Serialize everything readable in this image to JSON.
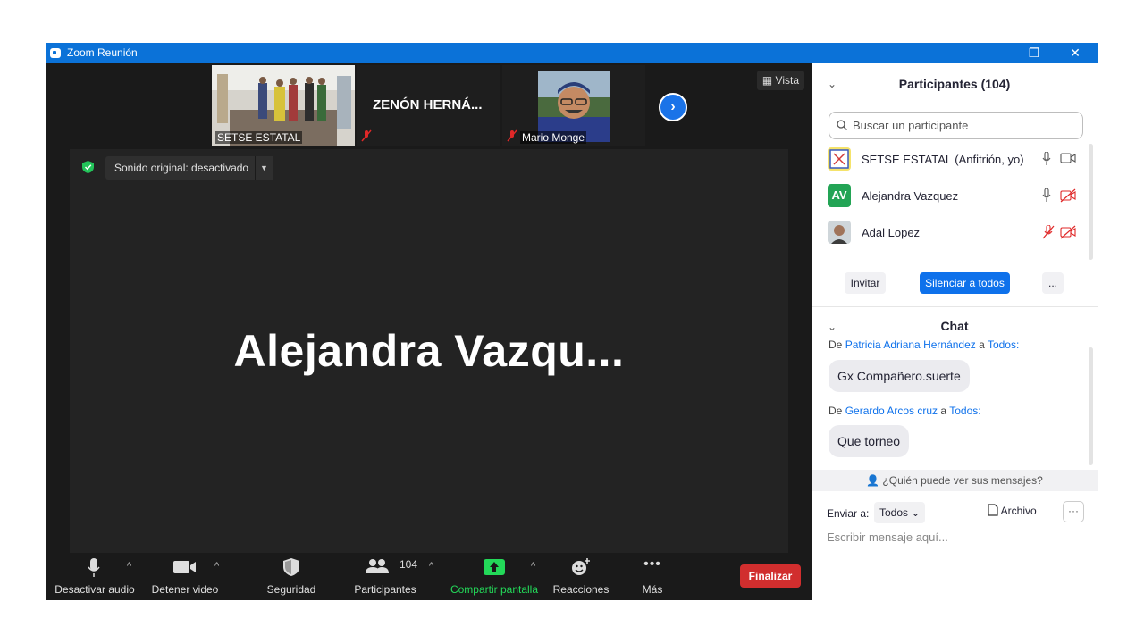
{
  "window": {
    "title": "Zoom Reunión",
    "minimize": "—",
    "restore": "❐",
    "close": "✕"
  },
  "gallery": {
    "thumbs": [
      {
        "name": "SETSE ESTATAL"
      },
      {
        "name": "ZENÓN  HERNÁ..."
      },
      {
        "name": "Mario  Monge"
      }
    ],
    "vista_label": "Vista",
    "next_arrow": "›"
  },
  "main": {
    "sound_original": "Sonido original: desactivado",
    "speaker_name": "Alejandra  Vazqu..."
  },
  "toolbar": {
    "audio": "Desactivar audio",
    "video": "Detener video",
    "security": "Seguridad",
    "participants": "Participantes",
    "participants_count": "104",
    "share": "Compartir pantalla",
    "reactions": "Reacciones",
    "more": "Más",
    "end": "Finalizar",
    "share_color": "#23d959",
    "end_color": "#d12e2e"
  },
  "participants_panel": {
    "header": "Participantes (104)",
    "search_placeholder": "Buscar un participante",
    "rows": [
      {
        "name": "SETSE ESTATAL (Anfitrión, yo)",
        "mic": "on",
        "cam": "on"
      },
      {
        "name": "Alejandra Vazquez",
        "initials": "AV",
        "mic": "on",
        "cam": "off"
      },
      {
        "name": "Adal Lopez",
        "mic": "off",
        "cam": "off"
      }
    ],
    "invite": "Invitar",
    "mute_all": "Silenciar a todos",
    "more": "..."
  },
  "chat": {
    "header": "Chat",
    "messages": [
      {
        "from_prefix": "De",
        "from": "Patricia Adriana Hernández",
        "to_prefix": "a",
        "to": "Todos:",
        "text": "Gx Compañero.suerte"
      },
      {
        "from_prefix": "De",
        "from": "Gerardo Arcos cruz",
        "to_prefix": "a",
        "to": "Todos:",
        "text": "Que torneo"
      }
    ],
    "who_can_see": "¿Quién puede ver sus mensajes?",
    "send_to": "Enviar a:",
    "send_to_value": "Todos",
    "file": "Archivo",
    "more": "···",
    "input_placeholder": "Escribir mensaje aquí..."
  },
  "colors": {
    "titlebar": "#0b72d8",
    "accent_blue": "#0e71eb",
    "avatar_green": "#23a455"
  }
}
